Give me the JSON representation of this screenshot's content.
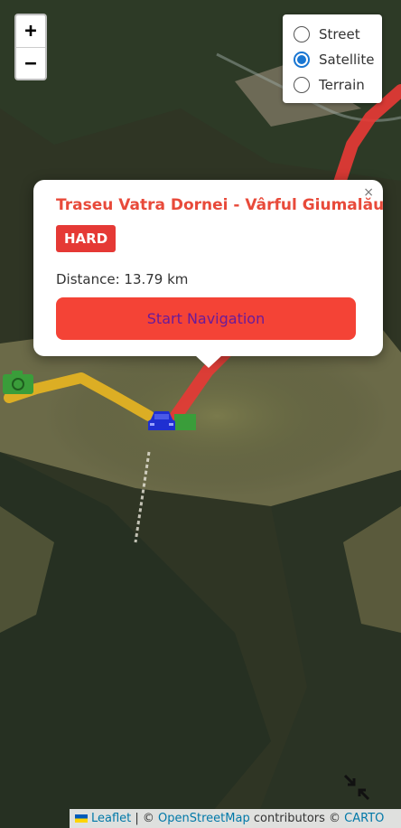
{
  "zoom": {
    "in_label": "+",
    "out_label": "−"
  },
  "layers": {
    "options": [
      {
        "label": "Street",
        "selected": false
      },
      {
        "label": "Satellite",
        "selected": true
      },
      {
        "label": "Terrain",
        "selected": false
      }
    ]
  },
  "popup": {
    "close_label": "×",
    "title": "Traseu Vatra Dornei - Vârful Giumalău",
    "difficulty": "HARD",
    "distance": "Distance: 13.79 km",
    "nav_button": "Start Navigation"
  },
  "colors": {
    "route_red": "#e53935",
    "route_yellow": "#e6b422",
    "badge_red": "#e53935",
    "title_red": "#e84a3a",
    "button_text": "#6a1b9a",
    "radio_selected": "#1976d2"
  },
  "attribution": {
    "leaflet": "Leaflet",
    "separator": " | © ",
    "osm": "OpenStreetMap",
    "contributors": " contributors © ",
    "carto": "CARTO"
  },
  "icons": {
    "camera": "camera-icon",
    "car": "car-icon",
    "fullscreen": "exit-fullscreen-icon"
  }
}
